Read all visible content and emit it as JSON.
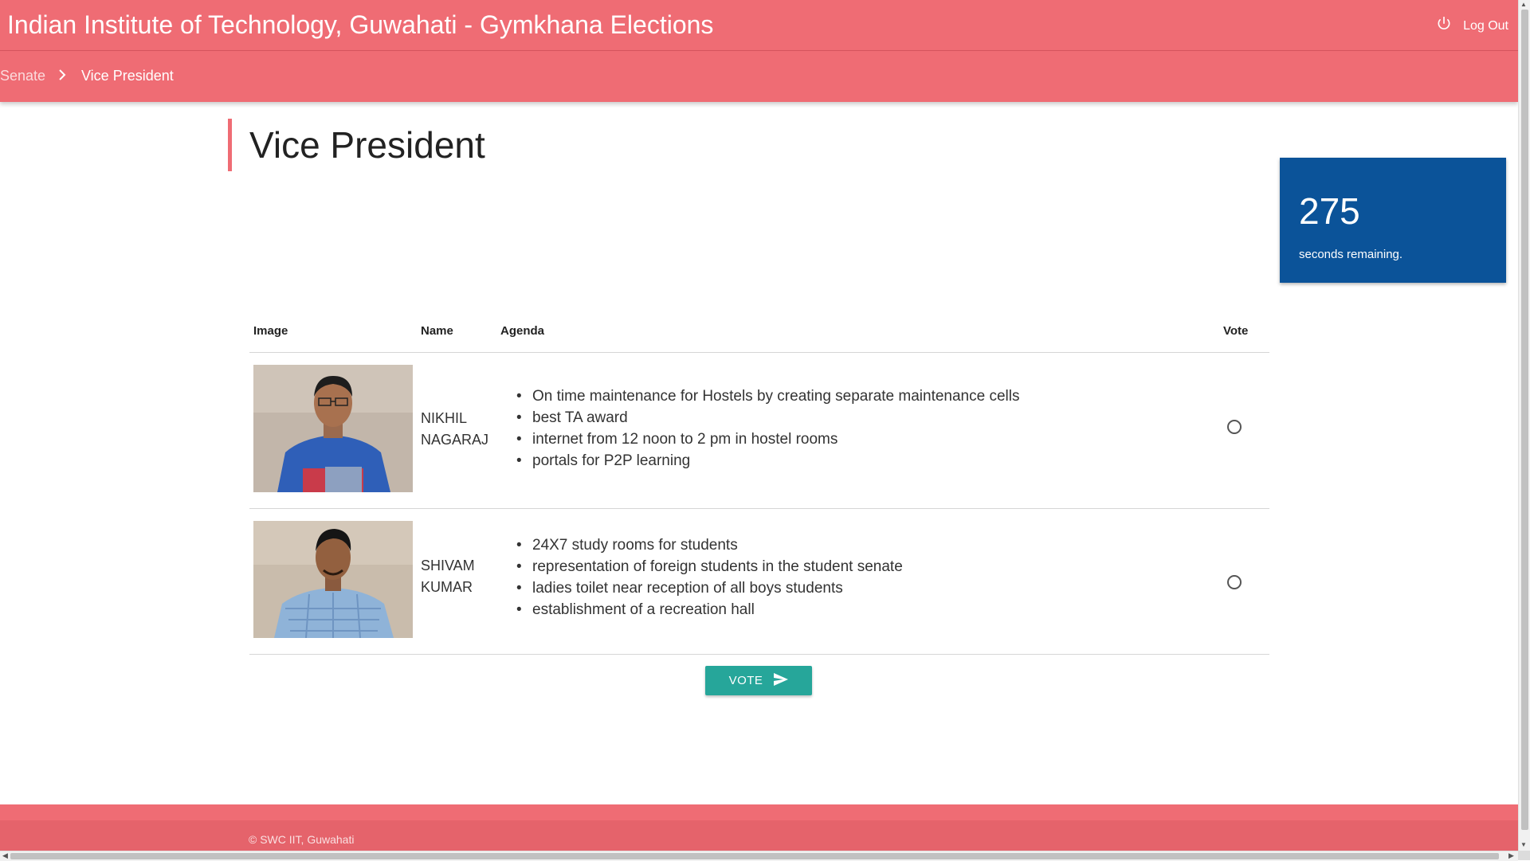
{
  "header": {
    "title": "Indian Institute of Technology, Guwahati - Gymkhana Elections",
    "logout_label": "Log Out"
  },
  "breadcrumb": {
    "items": [
      "Senate",
      "Vice President"
    ]
  },
  "page": {
    "title": "Vice President"
  },
  "timer": {
    "value": "275",
    "label": "seconds remaining."
  },
  "table": {
    "headers": [
      "Image",
      "Name",
      "Agenda",
      "Vote"
    ],
    "candidates": [
      {
        "name_line1": "NIKHIL",
        "name_line2": "NAGARAJ",
        "agenda": [
          "On time maintenance for Hostels by creating separate maintenance cells",
          "best TA award",
          "internet from 12 noon to 2 pm in hostel rooms",
          "portals for P2P learning"
        ]
      },
      {
        "name_line1": "SHIVAM",
        "name_line2": "KUMAR",
        "agenda": [
          "24X7 study rooms for students",
          "representation of foreign students in the student senate",
          "ladies toilet near reception of all boys students",
          "establishment of a recreation hall"
        ]
      }
    ]
  },
  "vote_button": {
    "label": "VOTE"
  },
  "footer": {
    "copyright": "© SWC IIT, Guwahati"
  },
  "colors": {
    "primary": "#ef6c74",
    "timer_bg": "#0b5399",
    "vote_button": "#26a69a"
  },
  "icons": {
    "logout": "power-icon",
    "breadcrumb_separator": "chevron-right-icon",
    "vote": "send-icon"
  }
}
